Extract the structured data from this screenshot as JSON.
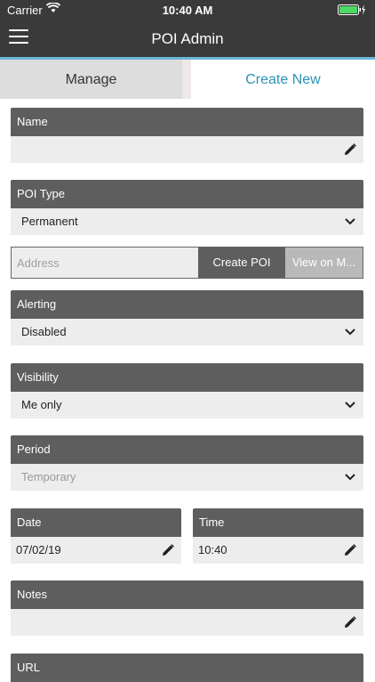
{
  "status_bar": {
    "carrier": "Carrier",
    "time": "10:40 AM"
  },
  "nav": {
    "title": "POI Admin"
  },
  "tabs": [
    {
      "label": "Manage",
      "active": false
    },
    {
      "label": "Create New",
      "active": true
    }
  ],
  "form": {
    "name": {
      "label": "Name",
      "value": ""
    },
    "poi_type": {
      "label": "POI Type",
      "value": "Permanent"
    },
    "address": {
      "placeholder": "Address",
      "create_label": "Create POI",
      "view_label": "View on M..."
    },
    "alerting": {
      "label": "Alerting",
      "value": "Disabled"
    },
    "visibility": {
      "label": "Visibility",
      "value": "Me only"
    },
    "period": {
      "label": "Period",
      "value": "Temporary"
    },
    "date": {
      "label": "Date",
      "value": "07/02/19"
    },
    "time": {
      "label": "Time",
      "value": "10:40"
    },
    "notes": {
      "label": "Notes",
      "value": ""
    },
    "url": {
      "label": "URL"
    }
  },
  "colors": {
    "accent": "#2a93b5",
    "header": "#5e5e5e",
    "nav": "#3a3a3a"
  },
  "icons": [
    "wifi-icon",
    "battery-icon",
    "hamburger-menu-icon",
    "pencil-edit-icon",
    "chevron-down-icon"
  ]
}
